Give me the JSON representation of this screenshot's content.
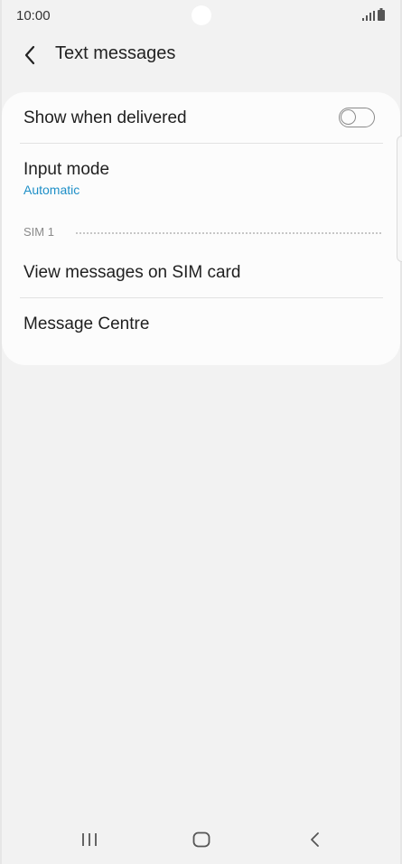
{
  "status_bar": {
    "time": "10:00",
    "icons": [
      "signal-icon",
      "battery-icon"
    ]
  },
  "header": {
    "back_icon": "chevron-left-icon",
    "title": "Text messages"
  },
  "settings": {
    "show_when_delivered": {
      "label": "Show when delivered",
      "toggle_on": false
    },
    "input_mode": {
      "label": "Input mode",
      "value": "Automatic"
    },
    "section_sim1": {
      "header": "SIM 1",
      "items": [
        {
          "label": "View messages on SIM card"
        },
        {
          "label": "Message Centre"
        }
      ]
    }
  },
  "colors": {
    "background": "#f2f2f2",
    "card": "#fcfcfc",
    "accent": "#1e8fc7",
    "secondary_text": "#8a8a8a"
  },
  "nav_bar": {
    "buttons": [
      "recent-apps-icon",
      "home-icon",
      "back-icon"
    ]
  }
}
